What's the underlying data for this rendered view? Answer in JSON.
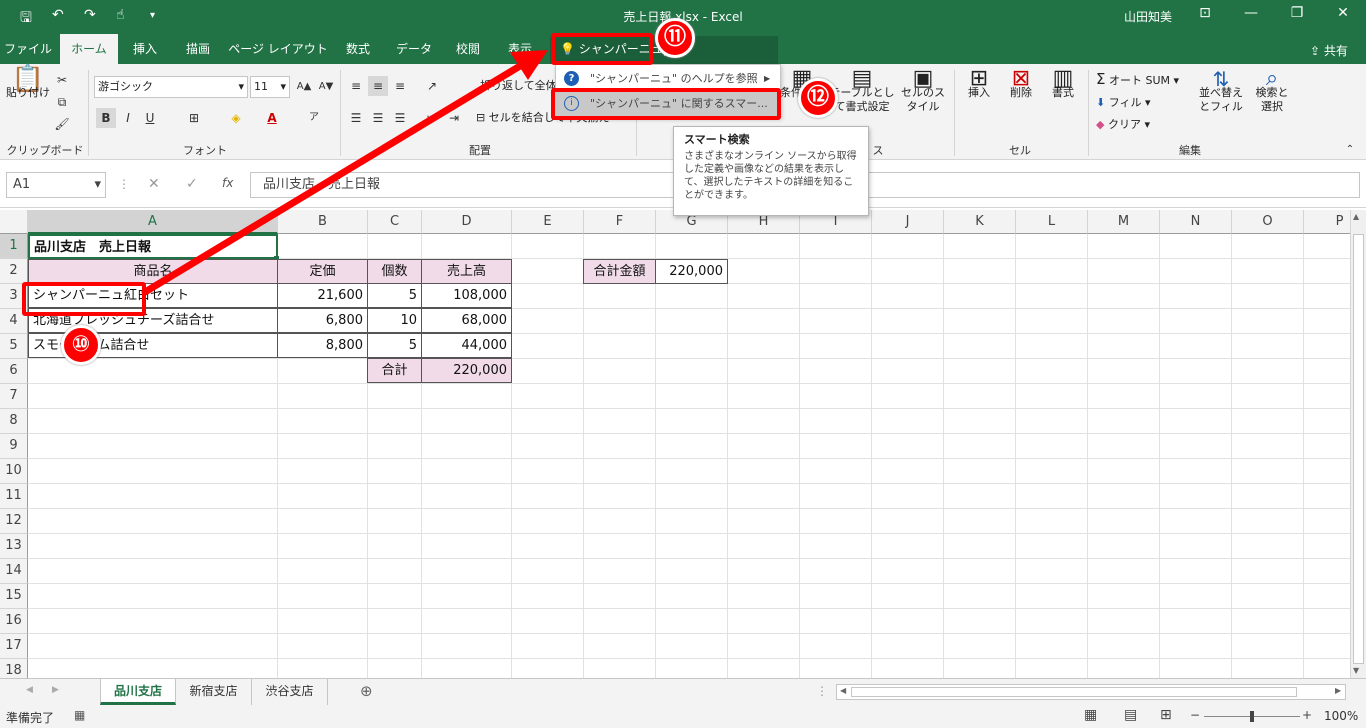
{
  "window": {
    "title": "売上日報.xlsx  -  Excel",
    "user": "山田知美"
  },
  "tabs": [
    "ファイル",
    "ホーム",
    "挿入",
    "描画",
    "ページ レイアウト",
    "数式",
    "データ",
    "校閲",
    "表示"
  ],
  "active_tab": "ホーム",
  "search": {
    "value": "シャンパーニュ",
    "share": "共有"
  },
  "ribbon": {
    "clipboard": {
      "paste": "貼り付け",
      "label": "クリップボード"
    },
    "font": {
      "name": "游ゴシック",
      "size": "11",
      "label": "フォント",
      "bold": "B",
      "italic": "I",
      "underline": "U"
    },
    "alignment": {
      "wrap": "折り返して全体を表示する",
      "merge": "セルを結合して中央揃え",
      "label": "配置"
    },
    "styles": {
      "conditional": "条件付き書式",
      "table": "テーブルとして書式設定",
      "cellstyle": "セルのスタイル",
      "label": "スタイル"
    },
    "cells": {
      "insert": "挿入",
      "delete": "削除",
      "format": "書式",
      "label": "セル"
    },
    "editing": {
      "autosum": "オート SUM",
      "fill": "フィル",
      "clear": "クリア",
      "sort": "並べ替えとフィルター",
      "find": "検索と選択",
      "label": "編集"
    }
  },
  "dropdown": {
    "help": "\"シャンパーニュ\" のヘルプを参照",
    "smart": "\"シャンパーニュ\" に関するスマー..."
  },
  "tooltip": {
    "title": "スマート検索",
    "body": "さまざまなオンライン ソースから取得した定義や画像などの結果を表示して、選択したテキストの詳細を知ることができます。"
  },
  "formula": {
    "namebox": "A1",
    "content": "品川支店　売上日報"
  },
  "columns": [
    "A",
    "B",
    "C",
    "D",
    "E",
    "F",
    "G",
    "H",
    "I",
    "J",
    "K",
    "L",
    "M",
    "N",
    "O",
    "P"
  ],
  "rows": [
    "1",
    "2",
    "3",
    "4",
    "5",
    "6",
    "7",
    "8",
    "9",
    "10",
    "11",
    "12",
    "13",
    "14",
    "15",
    "16",
    "17",
    "18"
  ],
  "cells": {
    "a1": "品川支店　売上日報",
    "header": {
      "name": "商品名",
      "price": "定価",
      "qty": "個数",
      "sales": "売上高"
    },
    "items": [
      {
        "name": "シャンパーニュ紅白セット",
        "price": "21,600",
        "qty": "5",
        "sales": "108,000"
      },
      {
        "name": "北海道フレッシュチーズ詰合せ",
        "price": "6,800",
        "qty": "10",
        "sales": "68,000"
      },
      {
        "name": "スモークハム詰合せ",
        "price": "8,800",
        "qty": "5",
        "sales": "44,000"
      }
    ],
    "total_label": "合計",
    "total": "220,000",
    "grand_label": "合計金額",
    "grand": "220,000"
  },
  "sheets": [
    "品川支店",
    "新宿支店",
    "渋谷支店"
  ],
  "status": {
    "ready": "準備完了",
    "zoom": "100%"
  },
  "annotations": {
    "b10": "⑩",
    "b11": "⑪",
    "b12": "⑫"
  }
}
